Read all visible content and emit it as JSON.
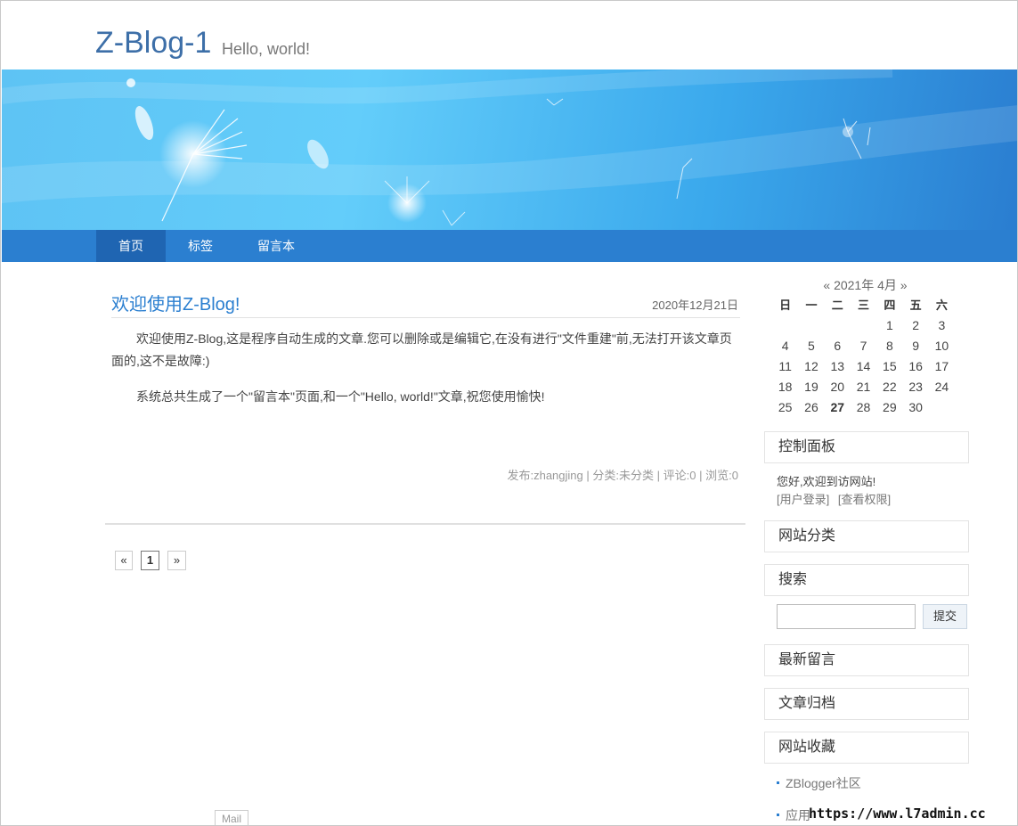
{
  "site": {
    "title": "Z-Blog-1",
    "subtitle": "Hello, world!"
  },
  "nav": {
    "items": [
      "首页",
      "标签",
      "留言本"
    ]
  },
  "post": {
    "title": "欢迎使用Z-Blog!",
    "date": "2020年12月21日",
    "paragraphs": [
      "欢迎使用Z-Blog,这是程序自动生成的文章.您可以删除或是编辑它,在没有进行\"文件重建\"前,无法打开该文章页面的,这不是故障:)",
      "系统总共生成了一个\"留言本\"页面,和一个\"Hello, world!\"文章,祝您使用愉快!"
    ],
    "meta": {
      "author": "发布:zhangjing",
      "category": "分类:未分类",
      "comments": "评论:0",
      "views": "浏览:0",
      "separator": "|"
    }
  },
  "pagination": {
    "prev": "«",
    "current": "1",
    "next": "»"
  },
  "calendar": {
    "prev": "«",
    "title": "2021年 4月",
    "next": "»",
    "weekdays": [
      "日",
      "一",
      "二",
      "三",
      "四",
      "五",
      "六"
    ],
    "rows": [
      [
        "",
        "",
        "",
        "",
        "1",
        "2",
        "3"
      ],
      [
        "4",
        "5",
        "6",
        "7",
        "8",
        "9",
        "10"
      ],
      [
        "11",
        "12",
        "13",
        "14",
        "15",
        "16",
        "17"
      ],
      [
        "18",
        "19",
        "20",
        "21",
        "22",
        "23",
        "24"
      ],
      [
        "25",
        "26",
        "27",
        "28",
        "29",
        "30",
        ""
      ]
    ],
    "today": "27"
  },
  "sidebar": {
    "control_panel": {
      "title": "控制面板",
      "welcome": "您好,欢迎到访网站!",
      "login": "[用户登录]",
      "permissions": "[查看权限]"
    },
    "categories_title": "网站分类",
    "search": {
      "title": "搜索",
      "button": "提交",
      "value": ""
    },
    "latest_comments_title": "最新留言",
    "archive_title": "文章归档",
    "favorites": {
      "title": "网站收藏",
      "items": [
        "ZBlogger社区",
        "应用"
      ]
    }
  },
  "mail_tab": "Mail",
  "watermark": "https://www.l7admin.cc",
  "colors": {
    "accent": "#2b7fd0",
    "nav_active": "#1f65b2",
    "title": "#3d6fa8"
  }
}
